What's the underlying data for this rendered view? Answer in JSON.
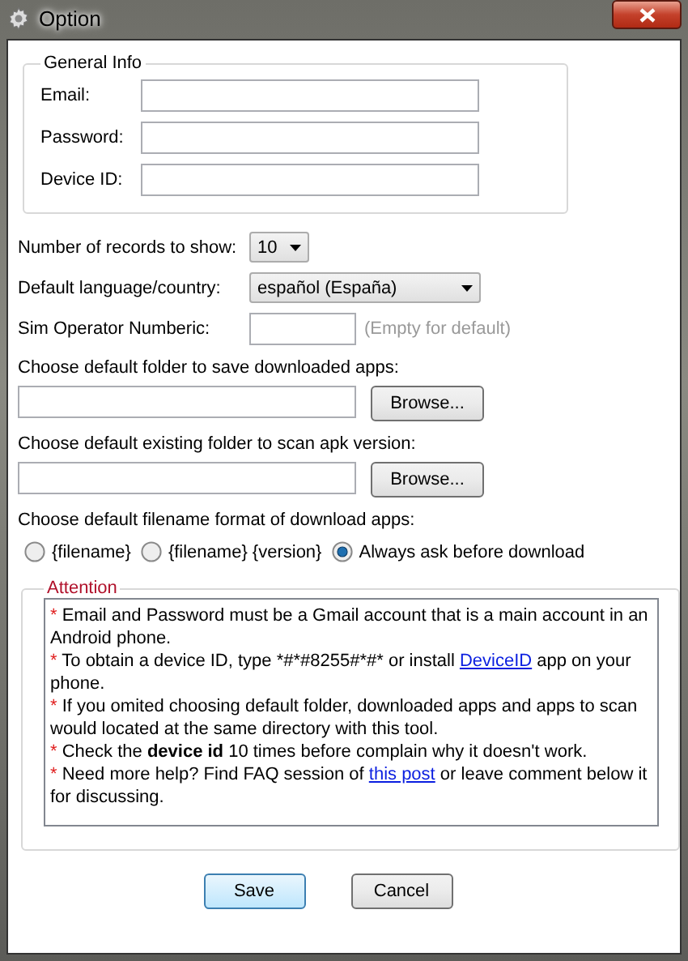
{
  "window": {
    "title": "Option"
  },
  "general_info": {
    "title": "General Info",
    "fields": [
      {
        "label": "Email:"
      },
      {
        "label": "Password:"
      },
      {
        "label": "Device ID:"
      }
    ]
  },
  "records": {
    "label": "Number of records  to show:",
    "value": "10"
  },
  "language": {
    "label": "Default language/country:",
    "value": "español (España)"
  },
  "sim_operator": {
    "label": "Sim Operator Numberic:",
    "hint": "(Empty for default)"
  },
  "save_folder": {
    "label": "Choose default folder to save downloaded apps:",
    "button": "Browse..."
  },
  "scan_folder": {
    "label": "Choose default existing folder to scan apk version:",
    "button": "Browse..."
  },
  "filename_format": {
    "label": "Choose default filename format of download apps:",
    "options": [
      {
        "label": "{filename}",
        "selected": false
      },
      {
        "label": "{filename} {version}",
        "selected": false
      },
      {
        "label": "Always ask before download",
        "selected": true
      }
    ]
  },
  "attention": {
    "title": "Attention",
    "notes": [
      {
        "marker": "*",
        "parts": [
          {
            "kind": "text",
            "text": "Email and Password must be a Gmail account that is a main account in an Android phone."
          }
        ]
      },
      {
        "marker": "*",
        "parts": [
          {
            "kind": "text",
            "text": "To obtain a device ID, type *#*#8255#*#* or install "
          },
          {
            "kind": "link",
            "text": "DeviceID"
          },
          {
            "kind": "text",
            "text": " app on your phone."
          }
        ]
      },
      {
        "marker": "*",
        "parts": [
          {
            "kind": "text",
            "text": "If you omited choosing default folder, downloaded apps and apps to scan would located at the same directory with this tool."
          }
        ]
      },
      {
        "marker": "*",
        "parts": [
          {
            "kind": "rich",
            "text": "Check the **device id** 10 times before complain why it doesn't work."
          }
        ]
      },
      {
        "marker": "*",
        "parts": [
          {
            "kind": "text",
            "text": "Need more help? Find FAQ session of "
          },
          {
            "kind": "link",
            "text": "this post"
          },
          {
            "kind": "text",
            "text": " or leave comment below it for discussing."
          }
        ]
      }
    ]
  },
  "buttons": [
    {
      "label": "Save",
      "kind": "default"
    },
    {
      "label": "Cancel",
      "kind": "normal"
    }
  ]
}
